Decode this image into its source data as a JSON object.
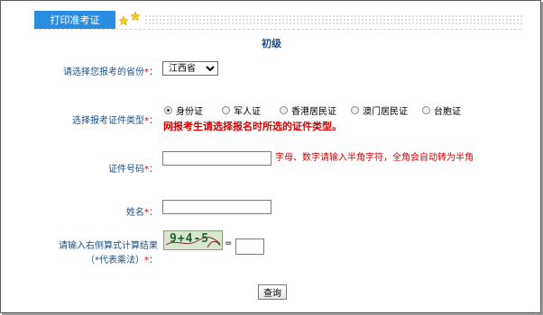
{
  "header": {
    "tab_label": "打印准考证"
  },
  "page": {
    "title": "初级"
  },
  "form": {
    "province_label": "请选择您报考的省份",
    "province_value": "江西省",
    "id_type_label": "选择报考证件类型",
    "id_types": [
      "身份证",
      "军人证",
      "香港居民证",
      "澳门居民证",
      "台胞证"
    ],
    "id_type_selected": "身份证",
    "id_type_warning": "网报考生请选择报名时所选的证件类型。",
    "id_number_label": "证件号码",
    "id_number_value": "",
    "id_number_hint": "字母、数字请输入半角字符，全角会自动转为半角",
    "name_label": "姓名",
    "name_value": "",
    "captcha_label_line1": "请输入右侧算式计算结果",
    "captcha_label_line2": "（*代表乘法）",
    "captcha_expression": "9+4-5",
    "captcha_answer": "",
    "equals_sign": "=",
    "required_mark": "*",
    "colon": "：",
    "submit_label": "查询"
  },
  "colors": {
    "tab_bg": "#2a8ee0",
    "label_text": "#1e4f82",
    "required_red": "#d40000",
    "star_yellow": "#f2c81a"
  }
}
